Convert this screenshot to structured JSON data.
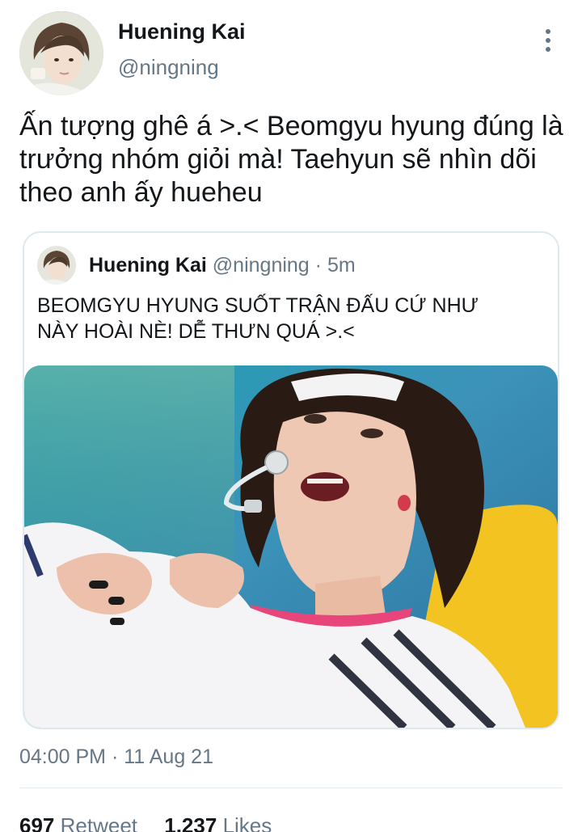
{
  "author": {
    "display_name": "Huening Kai",
    "handle": "@ningning"
  },
  "tweet": {
    "text": "Ấn tượng ghê á >.< Beomgyu hyung đúng là trưởng nhóm giỏi mà! Taehyun sẽ nhìn dõi theo anh ấy hueheu",
    "timestamp": "04:00 PM · 11 Aug 21"
  },
  "quoted": {
    "display_name": "Huening Kai",
    "handle": "@ningning",
    "separator": "·",
    "time": "5m",
    "text": "BEOMGYU HYUNG SUỐT TRẬN ĐẤU CỨ NHƯ NÀY HOÀI NÈ! DỄ THƯN QUÁ >.<"
  },
  "stats": {
    "retweets": "697",
    "retweet_label": "Retweet",
    "likes": "1,237",
    "likes_label": "Likes"
  },
  "icons": {
    "more": "more-vertical-icon"
  },
  "colors": {
    "secondary_text": "#657786",
    "primary_text": "#14171a",
    "border": "#dfe8ef"
  }
}
